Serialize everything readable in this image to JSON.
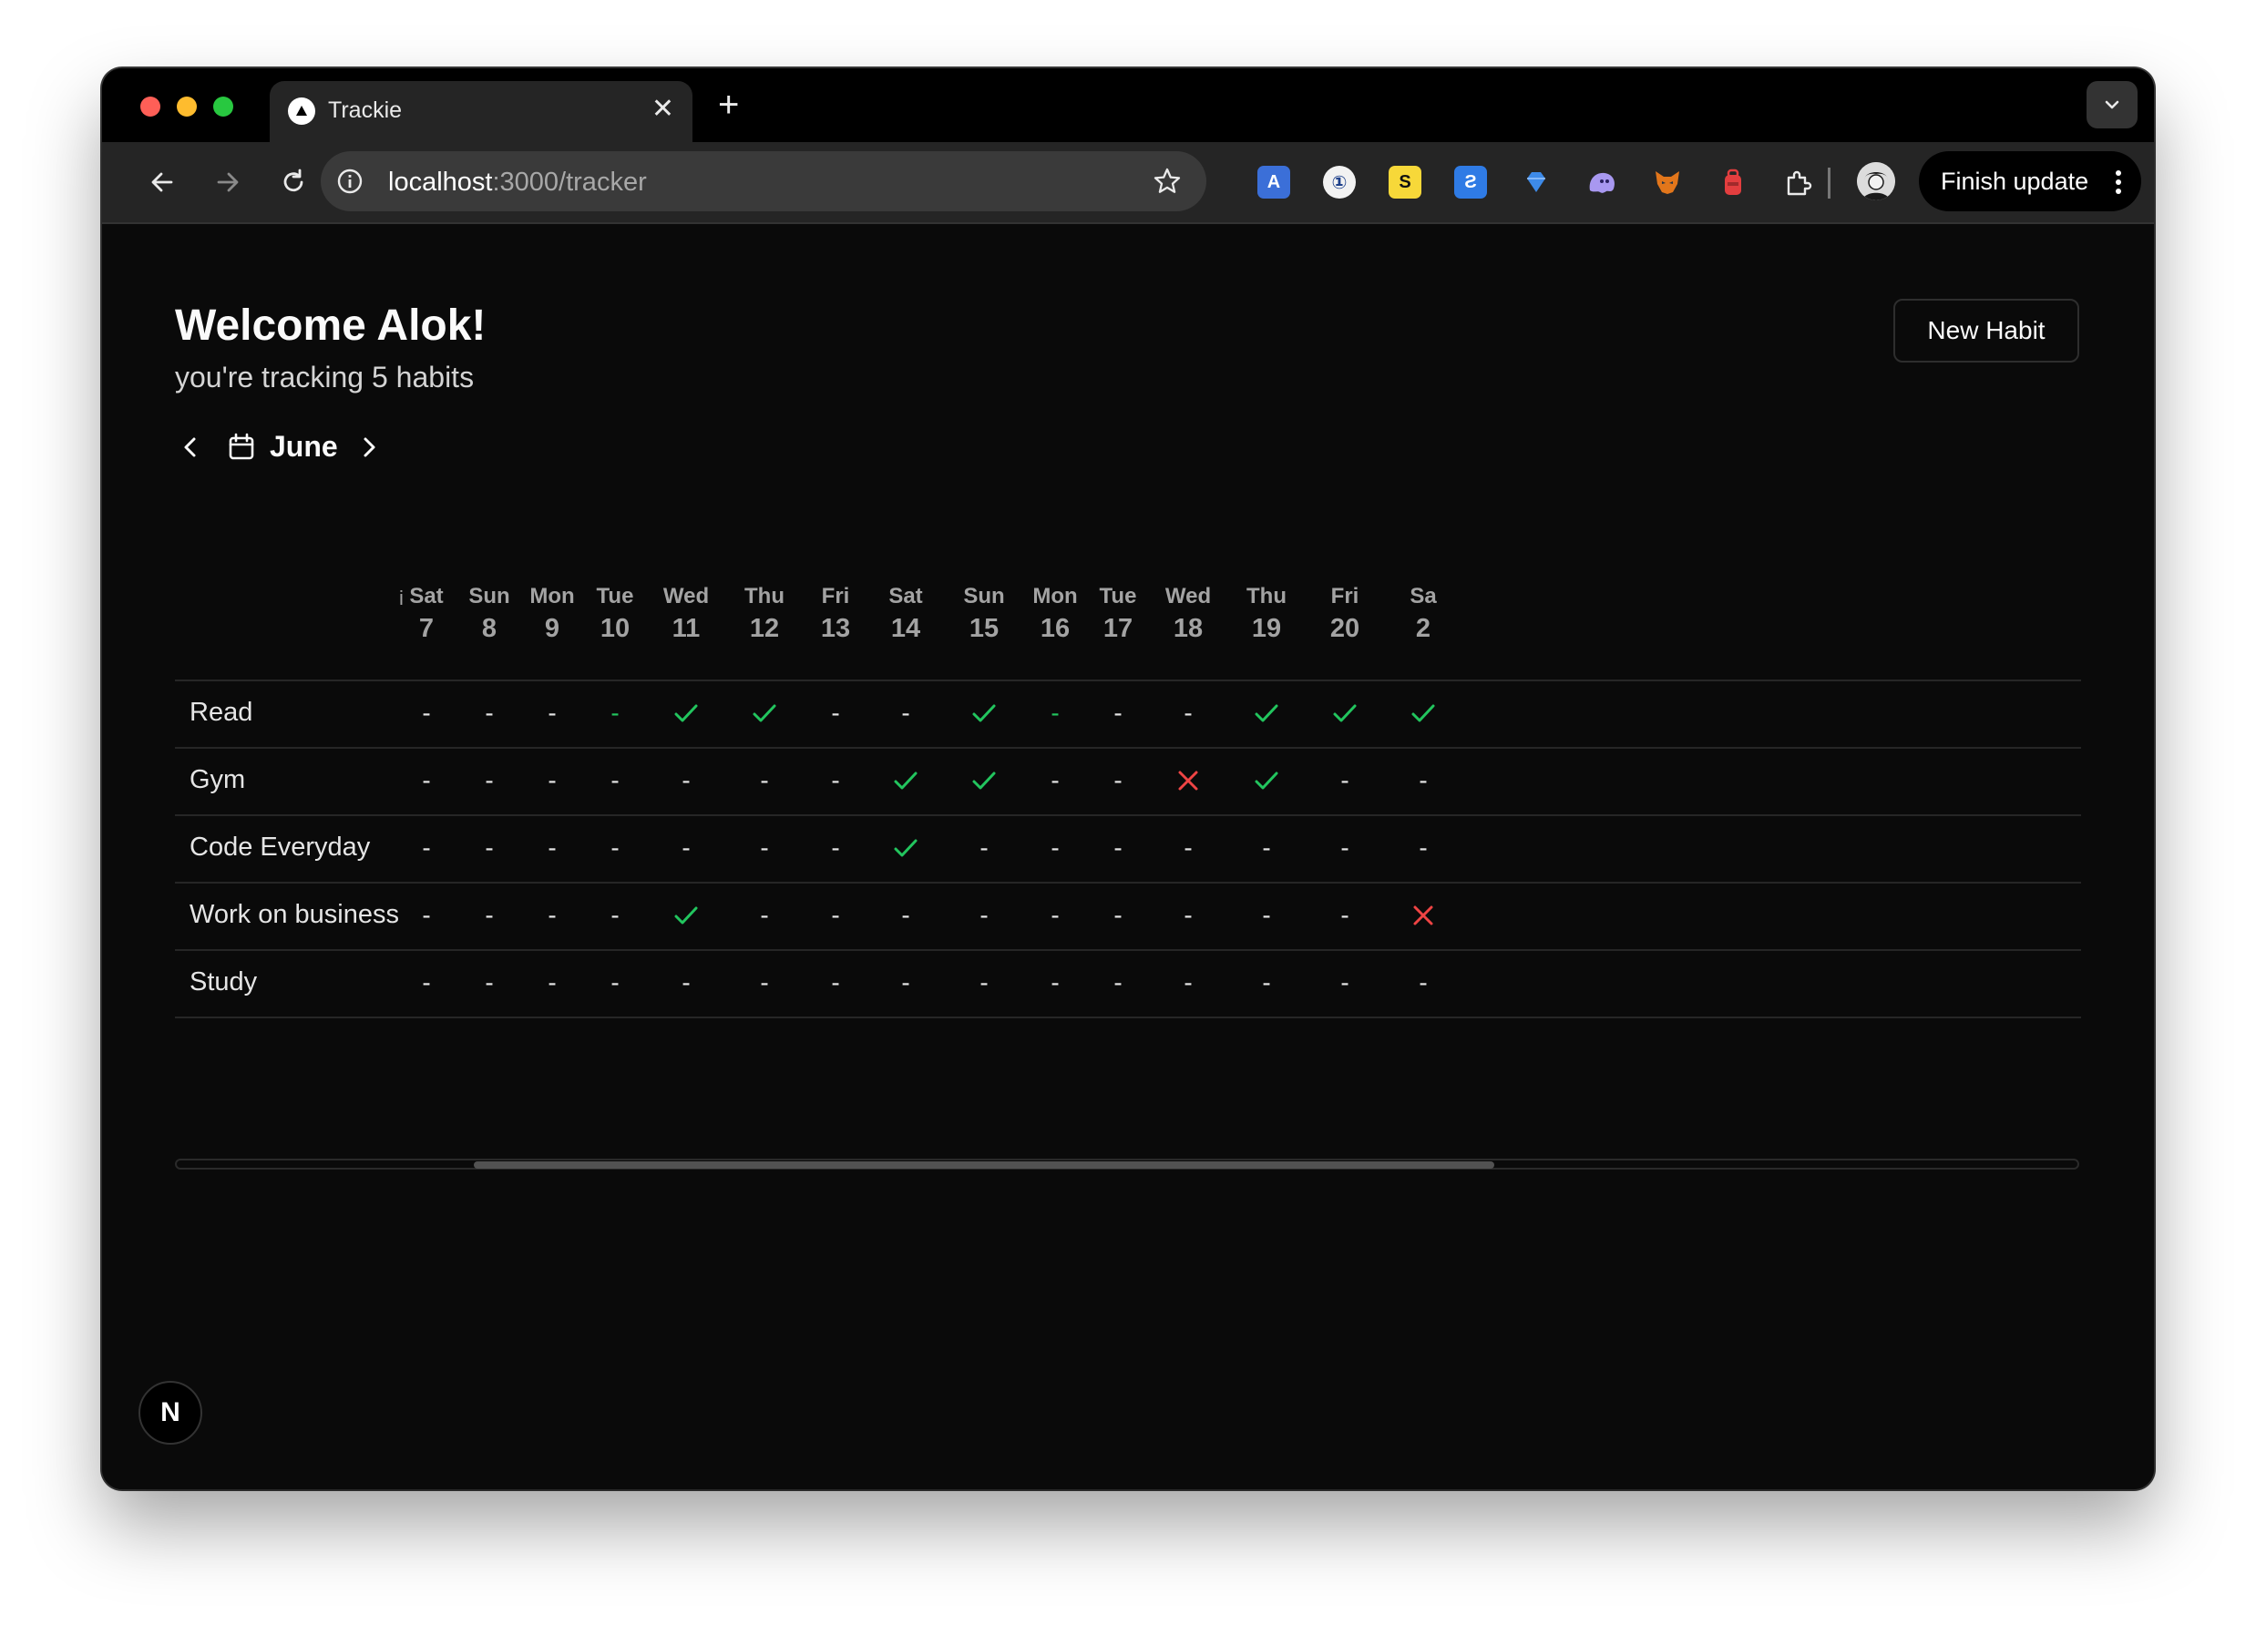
{
  "browser": {
    "tab_title": "Trackie",
    "tab_close": "✕",
    "new_tab": "+",
    "url_host": "localhost",
    "url_rest": ":3000/tracker",
    "finish_update": "Finish update"
  },
  "page": {
    "welcome": "Welcome Alok!",
    "subtitle": "you're tracking 5 habits",
    "new_habit": "New Habit",
    "month": "June",
    "info_mark": "i",
    "badge": "N"
  },
  "days": [
    {
      "name": "Sat",
      "date": "7"
    },
    {
      "name": "Sun",
      "date": "8"
    },
    {
      "name": "Mon",
      "date": "9"
    },
    {
      "name": "Tue",
      "date": "10"
    },
    {
      "name": "Wed",
      "date": "11"
    },
    {
      "name": "Thu",
      "date": "12"
    },
    {
      "name": "Fri",
      "date": "13"
    },
    {
      "name": "Sat",
      "date": "14"
    },
    {
      "name": "Sun",
      "date": "15"
    },
    {
      "name": "Mon",
      "date": "16"
    },
    {
      "name": "Tue",
      "date": "17"
    },
    {
      "name": "Wed",
      "date": "18"
    },
    {
      "name": "Thu",
      "date": "19"
    },
    {
      "name": "Fri",
      "date": "20"
    },
    {
      "name": "Sa",
      "date": "2"
    }
  ],
  "habits": [
    {
      "name": "Read",
      "cells": [
        "-",
        "-",
        "-",
        "g",
        "check",
        "check",
        "-",
        "-",
        "check",
        "g",
        "-",
        "-",
        "check",
        "check",
        "check"
      ]
    },
    {
      "name": "Gym",
      "cells": [
        "-",
        "-",
        "-",
        "-",
        "-",
        "-",
        "-",
        "check",
        "check",
        "-",
        "-",
        "cross",
        "check",
        "-",
        "-"
      ]
    },
    {
      "name": "Code Everyday",
      "cells": [
        "-",
        "-",
        "-",
        "-",
        "-",
        "-",
        "-",
        "check",
        "-",
        "-",
        "-",
        "-",
        "-",
        "-",
        "-"
      ]
    },
    {
      "name": "Work on business",
      "cells": [
        "-",
        "-",
        "-",
        "-",
        "check",
        "-",
        "-",
        "-",
        "-",
        "-",
        "-",
        "-",
        "-",
        "-",
        "cross"
      ]
    },
    {
      "name": "Study",
      "cells": [
        "-",
        "-",
        "-",
        "-",
        "-",
        "-",
        "-",
        "-",
        "-",
        "-",
        "-",
        "-",
        "-",
        "-",
        "-"
      ]
    }
  ],
  "colors": {
    "check": "#22c55e",
    "cross": "#ef4444",
    "background": "#0a0a0a"
  }
}
